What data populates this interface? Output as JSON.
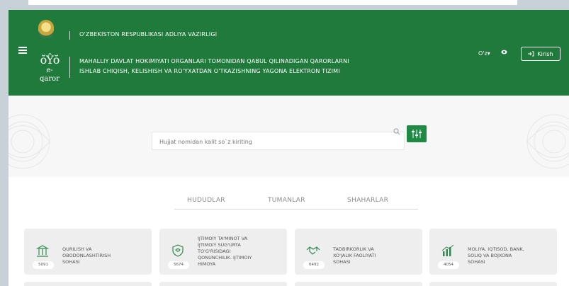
{
  "header": {
    "ministry": "O'ZBEKISTON RESPUBLIKASI ADLIYA VAZIRLIGI",
    "system_line1": "MAHALLIY DAVLAT HOKIMIYATI ORGANLARI TOMONIDAN QABUL QILINADIGAN QARORLARNI",
    "system_line2": "ISHLAB CHIQISH, KELISHISH VA RO'YXATDAN O'TKAZISHNING YAGONA ELEKTRON TIZIMI",
    "logo_word": "e-qaror",
    "language": "O'z",
    "login_label": "Kirish"
  },
  "search": {
    "placeholder": "Hujjat nomidan kalit so`z kiriting"
  },
  "tabs": [
    "HUDUDLAR",
    "TUMANLAR",
    "SHAHARLAR"
  ],
  "cards": [
    {
      "count": "5091",
      "lines": [
        "QURILISH VA",
        "OBODONLASHTIRISH",
        "SOHASI"
      ],
      "icon": "building-icon"
    },
    {
      "count": "5674",
      "lines": [
        "IJTIMOIY TA'MINOT VA",
        "IJTIMOIY SUG'URTA",
        "TO'G'RISIDAGI",
        "QONUNCHILIK. IJTIMOIY",
        "HIMOYA"
      ],
      "icon": "shield-heart-icon"
    },
    {
      "count": "6492",
      "lines": [
        "TADBIRKORLIK VA",
        "XO'JALIK FAOLIYATI",
        "SOHASI"
      ],
      "icon": "handshake-icon"
    },
    {
      "count": "4054",
      "lines": [
        "MOLIYA, IQTISOD, BANK,",
        "SOLIQ VA BOJXONA",
        "SOHASI"
      ],
      "icon": "finance-chart-icon"
    }
  ],
  "colors": {
    "primary": "#1f7a3c",
    "accent": "#1f8a44"
  }
}
